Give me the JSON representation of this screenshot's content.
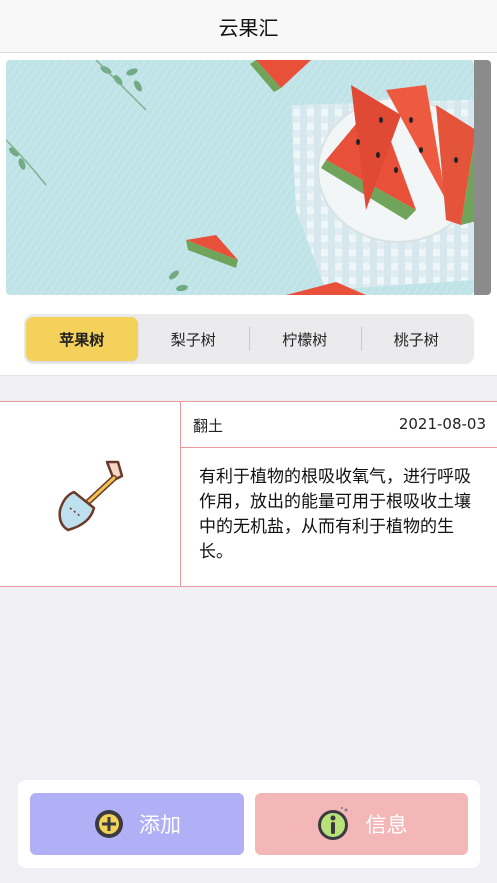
{
  "navbar": {
    "title": "云果汇"
  },
  "banner": {
    "image": "watermelon-banner"
  },
  "tabs": [
    {
      "label": "苹果树",
      "active": true
    },
    {
      "label": "梨子树",
      "active": false
    },
    {
      "label": "柠檬树",
      "active": false
    },
    {
      "label": "桃子树",
      "active": false
    }
  ],
  "record": {
    "icon": "shovel-icon",
    "name": "翻土",
    "date": "2021-08-03",
    "description": "有利于植物的根吸收氧气，进行呼吸作用，放出的能量可用于根吸收土壤中的无机盐，从而有利于植物的生长。"
  },
  "actions": {
    "add_label": "添加",
    "info_label": "信息",
    "add_color": "#b1b0f6",
    "info_color": "#f4b7b7"
  },
  "theme": {
    "accent": "#f4d15a",
    "divider": "#e89a9a"
  }
}
